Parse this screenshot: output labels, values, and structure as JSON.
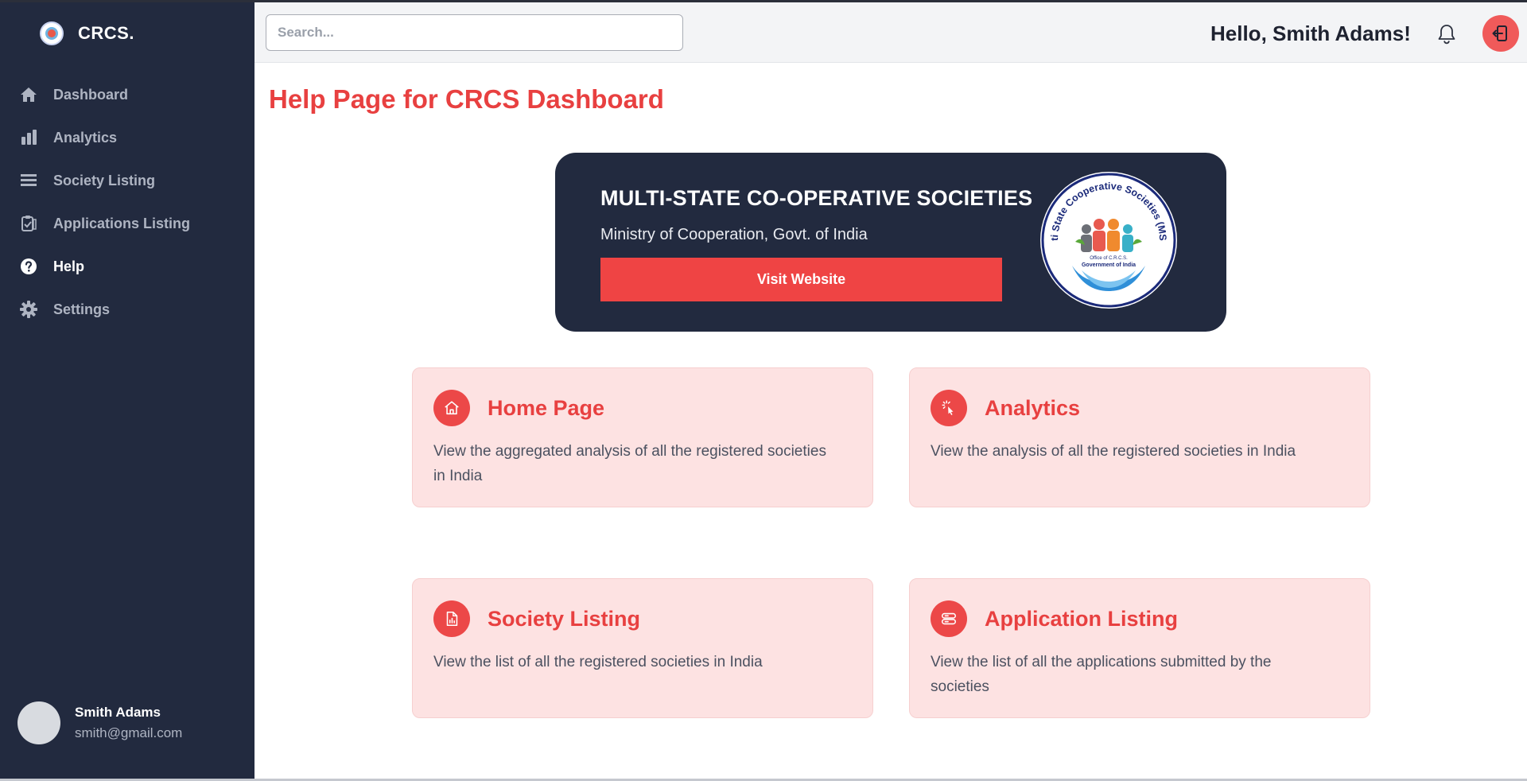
{
  "app": {
    "brand": "CRCS."
  },
  "sidebar": {
    "items": [
      {
        "label": "Dashboard",
        "icon": "home-icon",
        "active": false
      },
      {
        "label": "Analytics",
        "icon": "bar-chart-icon",
        "active": false
      },
      {
        "label": "Society Listing",
        "icon": "list-icon",
        "active": false
      },
      {
        "label": "Applications Listing",
        "icon": "clipboard-icon",
        "active": false
      },
      {
        "label": "Help",
        "icon": "help-icon",
        "active": true
      },
      {
        "label": "Settings",
        "icon": "gear-icon",
        "active": false
      }
    ],
    "user": {
      "name": "Smith Adams",
      "email": "smith@gmail.com"
    }
  },
  "header": {
    "search_placeholder": "Search...",
    "greeting": "Hello, Smith Adams!"
  },
  "main": {
    "title": "Help Page for CRCS Dashboard",
    "banner": {
      "title": "MULTI-STATE CO-OPERATIVE SOCIETIES",
      "subtitle": "Ministry of Cooperation, Govt. of India",
      "button": "Visit Website",
      "seal_text_ring": "Multi State Cooperative Societies (MSCS)",
      "seal_text_inner_1": "Office of C.R.C.S.",
      "seal_text_inner_2": "Government of India"
    },
    "cards": [
      {
        "title": "Home Page",
        "icon": "home-icon",
        "description": "View the aggregated analysis of all the registered societies in India"
      },
      {
        "title": "Analytics",
        "icon": "cursor-click-icon",
        "description": "View the analysis of all the registered societies in India"
      },
      {
        "title": "Society Listing",
        "icon": "document-chart-icon",
        "description": "View the list of all the registered societies in India"
      },
      {
        "title": "Application Listing",
        "icon": "server-icon",
        "description": "View the list of all the applications submitted by the societies"
      }
    ]
  },
  "colors": {
    "sidebar_bg": "#222a3f",
    "accent": "#e84040",
    "card_bg": "#fde2e2",
    "header_bg": "#f3f4f6"
  }
}
